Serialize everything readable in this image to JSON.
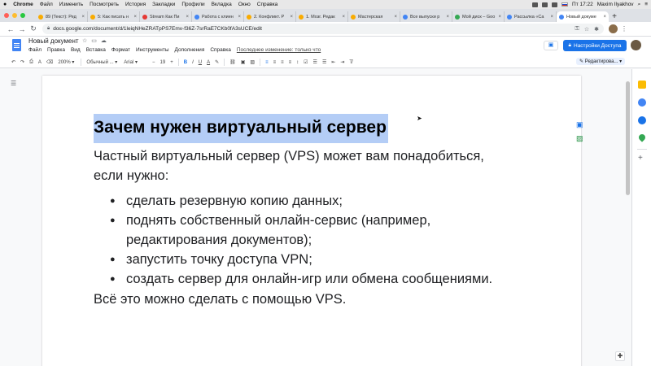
{
  "macbar": {
    "app": "Chrome",
    "menus": [
      "Файл",
      "Изменить",
      "Посмотреть",
      "История",
      "Закладки",
      "Профили",
      "Вкладка",
      "Окно",
      "Справка"
    ],
    "user": "Maxim Ilyakhov",
    "time": "Пт 17:22"
  },
  "tabs": [
    {
      "label": "89 (Текст): Ред",
      "color": "#f9ab00"
    },
    {
      "label": "5: Как писать н",
      "color": "#f9ab00"
    },
    {
      "label": "Stream Как Пи",
      "color": "#e53935"
    },
    {
      "label": "Работа с клиен",
      "color": "#4285f4"
    },
    {
      "label": "2. Конфликт. Р",
      "color": "#f9ab00"
    },
    {
      "label": "1. Мозг. Редак",
      "color": "#f9ab00"
    },
    {
      "label": "Мастерская",
      "color": "#f9ab00"
    },
    {
      "label": "Все выпуски р",
      "color": "#4285f4"
    },
    {
      "label": "Мой диск – Goo",
      "color": "#34a853"
    },
    {
      "label": "Рассылка «Са",
      "color": "#4285f4"
    },
    {
      "label": "Новый докуме",
      "color": "#4285f4",
      "active": true
    }
  ],
  "address": {
    "url": "docs.google.com/document/d/1leiqNHeZRATpPS7Emv-f36Z-7srRaE7CKb0fA3sUCE/edit"
  },
  "docs": {
    "title": "Новый документ",
    "menus": [
      "Файл",
      "Правка",
      "Вид",
      "Вставка",
      "Формат",
      "Инструменты",
      "Дополнения",
      "Справка"
    ],
    "last_edit": "Последнее изменение: только что",
    "share_label": "Настройки Доступа"
  },
  "toolbar": {
    "zoom": "200%",
    "style": "Обычный ...",
    "font": "Arial",
    "font_size": "19",
    "bold": "B",
    "italic": "I",
    "underline": "U",
    "text_color": "A",
    "mode": "Редактирова..."
  },
  "document": {
    "heading": "Зачем нужен виртуальный сервер",
    "intro": "Частный виртуальный сервер (VPS) может вам понадобиться, если нужно:",
    "bullets": [
      "сделать резервную копию данных;",
      "поднять собственный онлайн-сервис (например, редактирования документов);",
      "запустить точку доступа VPN;",
      "создать сервер для онлайн-игр или обмена сообщениями."
    ],
    "outro": "Всё это можно сделать с помощью VPS."
  }
}
